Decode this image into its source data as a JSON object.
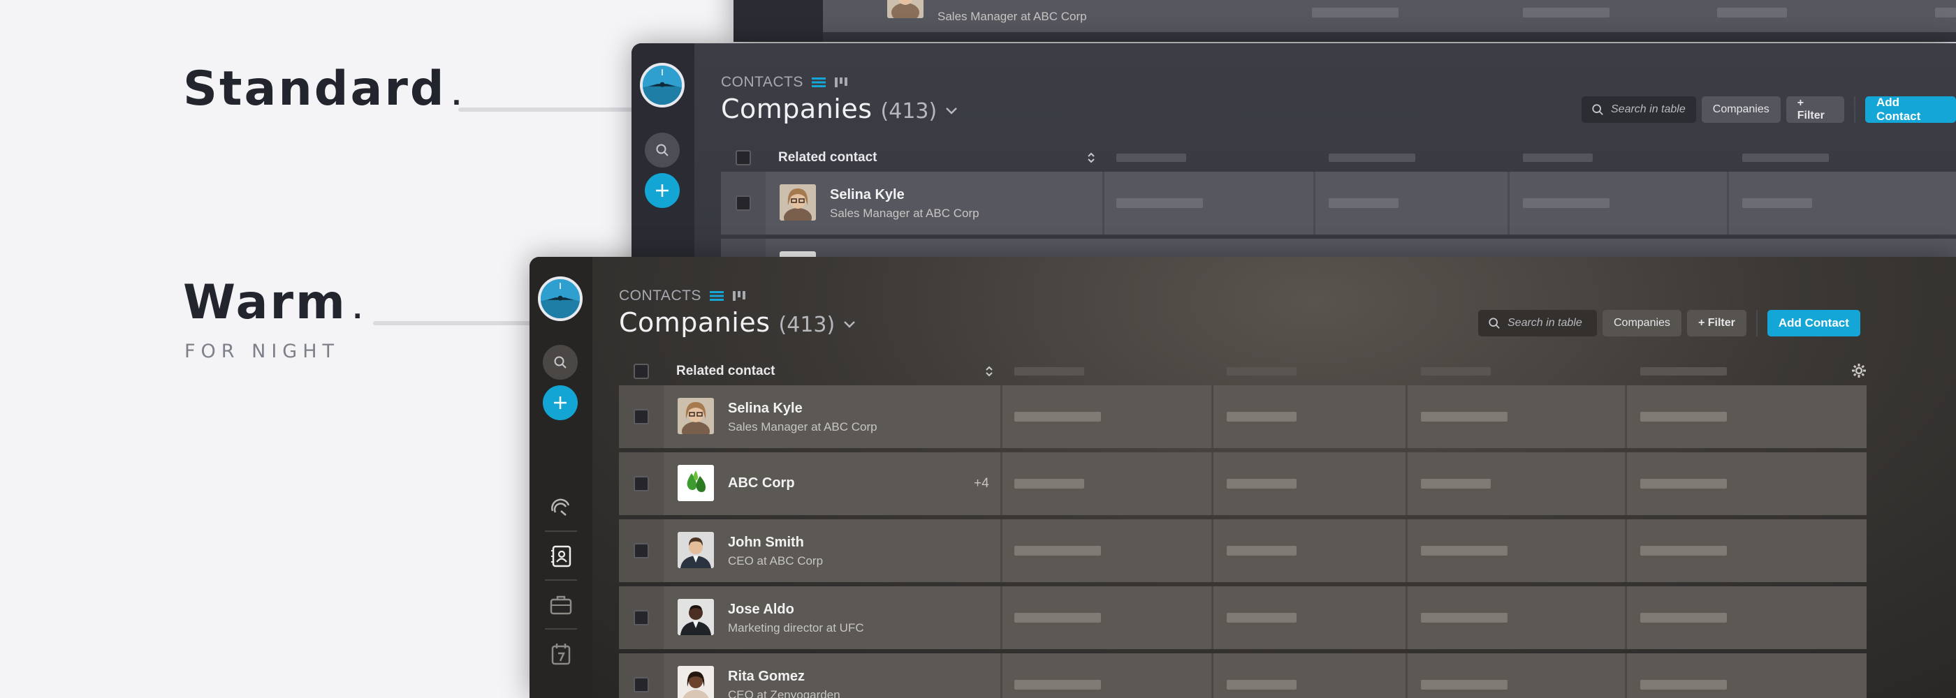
{
  "labels": {
    "standard": "Standard",
    "warm": "Warm",
    "warm_sub": "FOR NIGHT",
    "dot": "."
  },
  "app": {
    "breadcrumb": "CONTACTS",
    "title": "Companies",
    "count": "(413)",
    "search_placeholder": "Search in table",
    "companies_button": "Companies",
    "filter_button": "+ Filter",
    "add_contact_button": "Add Contact",
    "column_header": "Related contact"
  },
  "rows": [
    {
      "name": "Selina Kyle",
      "sub": "Sales Manager at ABC Corp"
    },
    {
      "name": "ABC Corp",
      "badge": "+4"
    },
    {
      "name": "John Smith",
      "sub": "CEO at ABC Corp"
    },
    {
      "name": "Jose Aldo",
      "sub": "Marketing director at UFC"
    },
    {
      "name": "Rita Gomez",
      "sub": "CEO at Zenyogarden"
    }
  ],
  "colors": {
    "accent": "#14a6d6",
    "page_bg": "#f4f4f6"
  }
}
